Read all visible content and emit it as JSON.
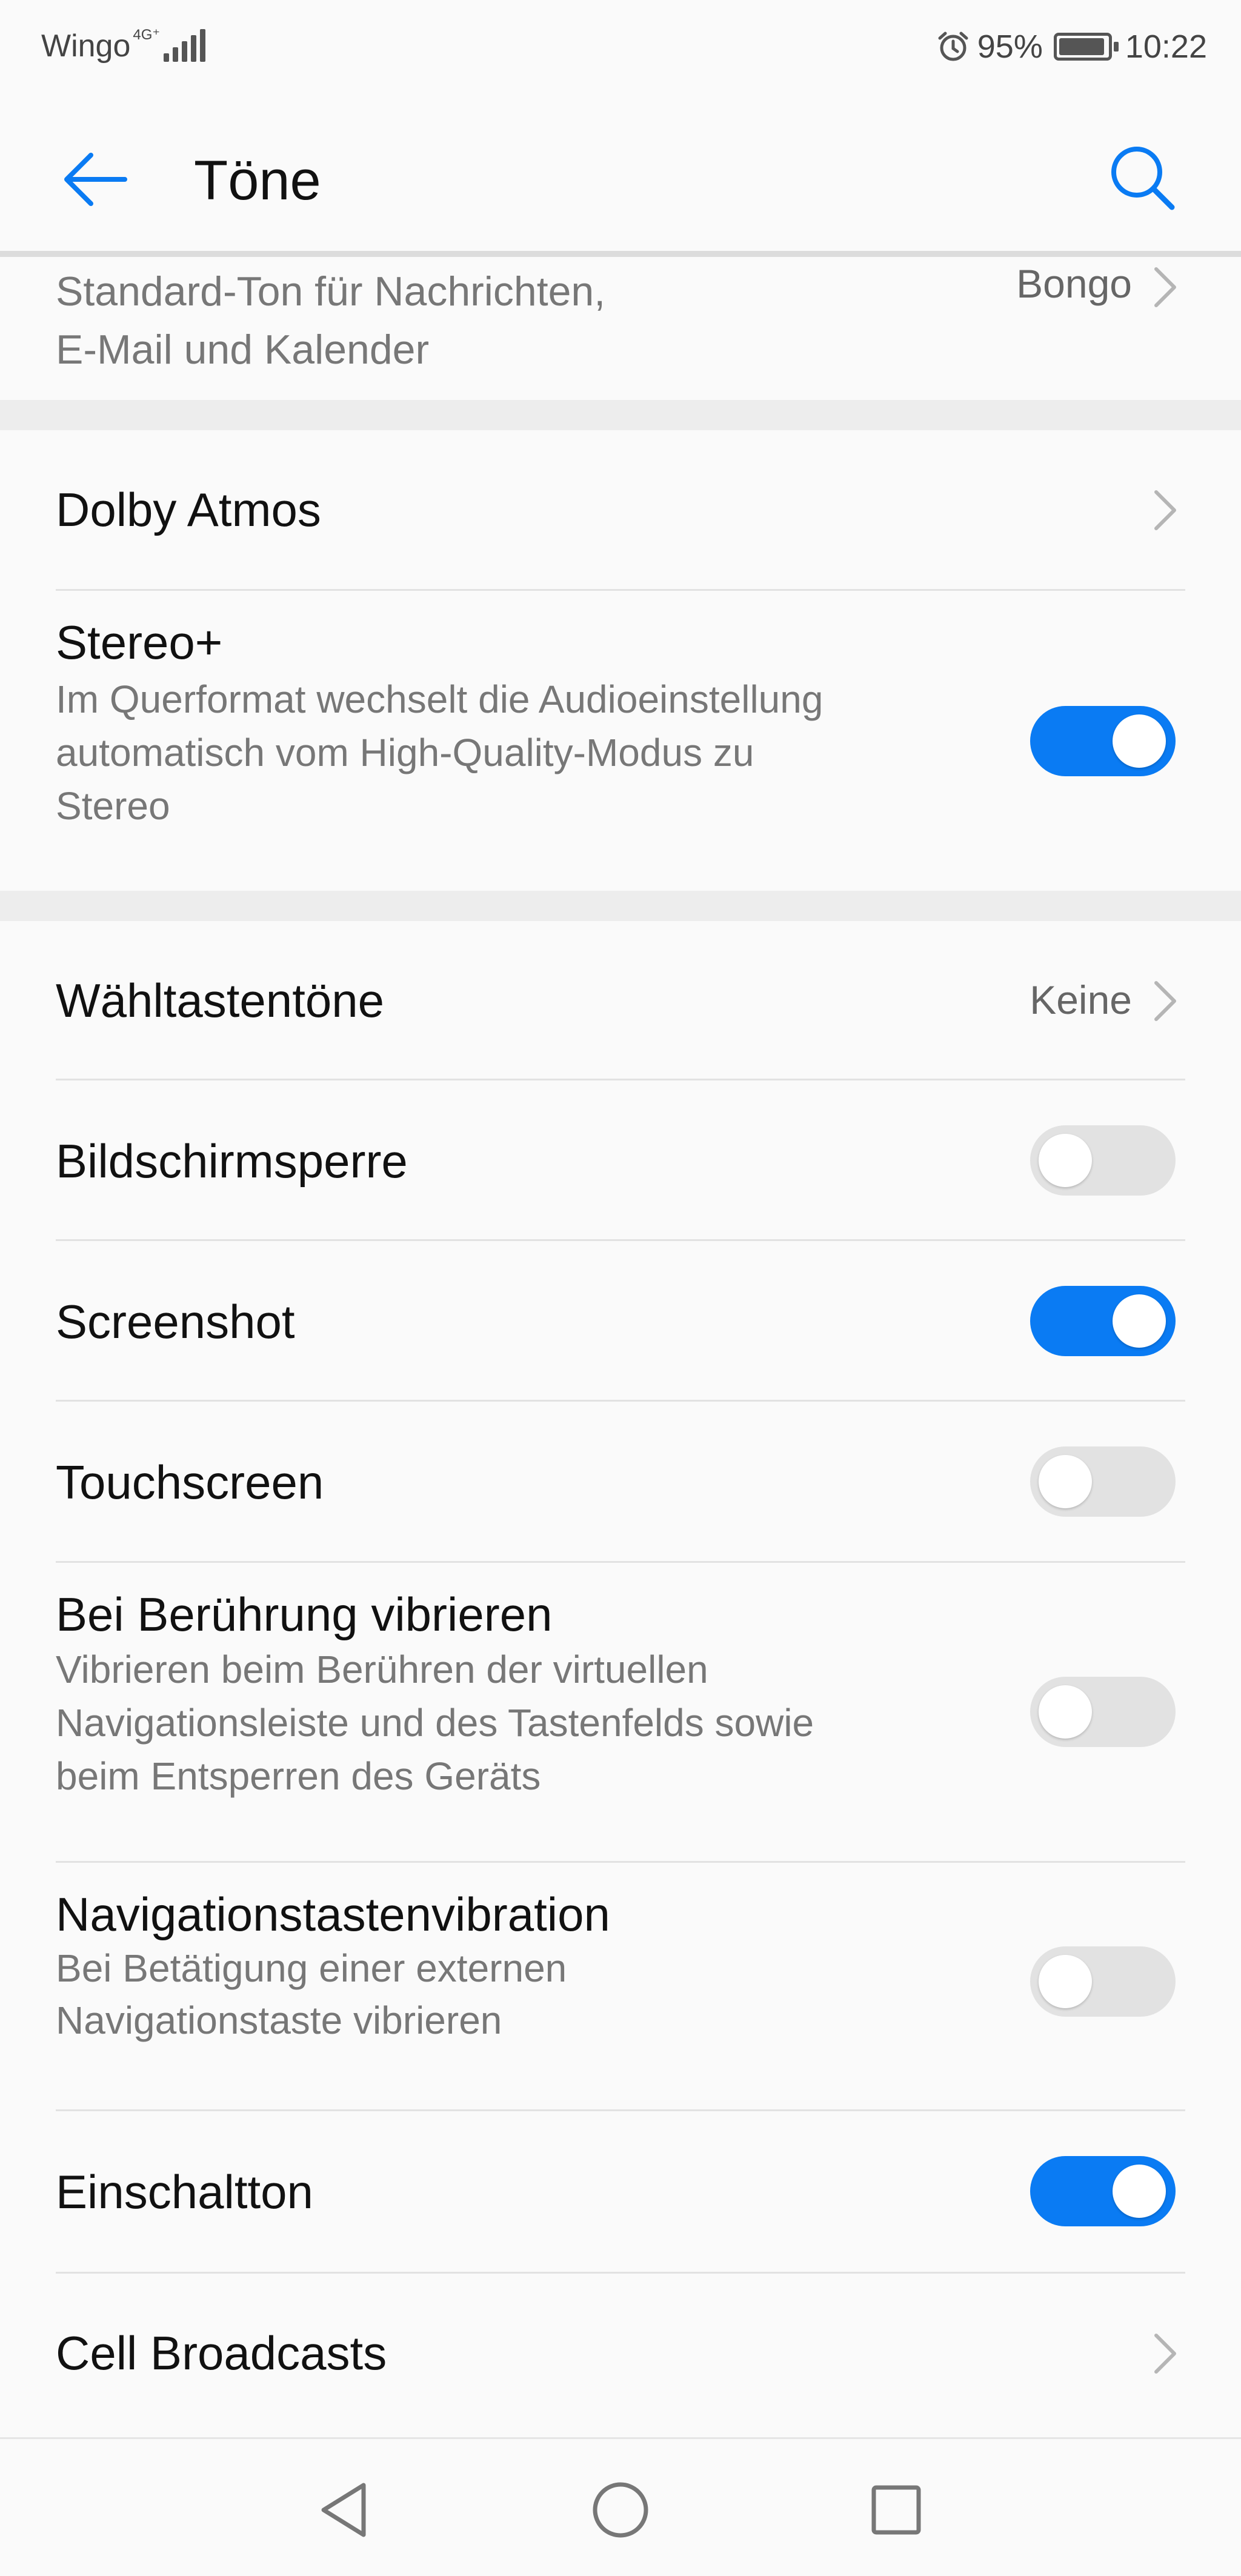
{
  "status_bar": {
    "carrier": "Wingo",
    "network": "4G⁺",
    "battery": "95%",
    "time": "10:22",
    "icons": [
      "signal-icon",
      "alarm-icon",
      "battery-icon"
    ]
  },
  "header": {
    "title": "Töne",
    "back_icon": "back-arrow-icon",
    "search_icon": "search-icon"
  },
  "rows": {
    "standard_tone": {
      "title_line1": "Standard-Ton für Nachrichten,",
      "title_line2": "E-Mail und Kalender",
      "value": "Bongo"
    },
    "dolby": {
      "title": "Dolby Atmos"
    },
    "stereo": {
      "title": "Stereo+",
      "sub1": "Im Querformat wechselt die Audioeinstellung",
      "sub2": "automatisch vom High-Quality-Modus zu",
      "sub3": "Stereo",
      "enabled": true
    },
    "dialpad": {
      "title": "Wähltastentöne",
      "value": "Keine"
    },
    "screen_lock": {
      "title": "Bildschirmsperre",
      "enabled": false
    },
    "screenshot": {
      "title": "Screenshot",
      "enabled": true
    },
    "touchscreen": {
      "title": "Touchscreen",
      "enabled": false
    },
    "vibrate_touch": {
      "title": "Bei Berührung vibrieren",
      "sub1": "Vibrieren beim Berühren der virtuellen",
      "sub2": "Navigationsleiste und des Tastenfelds sowie",
      "sub3": "beim Entsperren des Geräts",
      "enabled": false
    },
    "nav_vibration": {
      "title": "Navigationstastenvibration",
      "sub1": "Bei Betätigung einer externen",
      "sub2": "Navigationstaste vibrieren",
      "enabled": false
    },
    "power_on_tone": {
      "title": "Einschaltton",
      "enabled": true
    },
    "cell_broadcasts": {
      "title": "Cell Broadcasts"
    }
  },
  "colors": {
    "accent": "#0a7bf3",
    "toggle_off": "#e2e2e2",
    "background": "#fafafa",
    "section_gap": "#ededed"
  },
  "nav_bar": {
    "buttons": [
      "back-triangle-icon",
      "home-circle-icon",
      "recents-square-icon"
    ]
  }
}
